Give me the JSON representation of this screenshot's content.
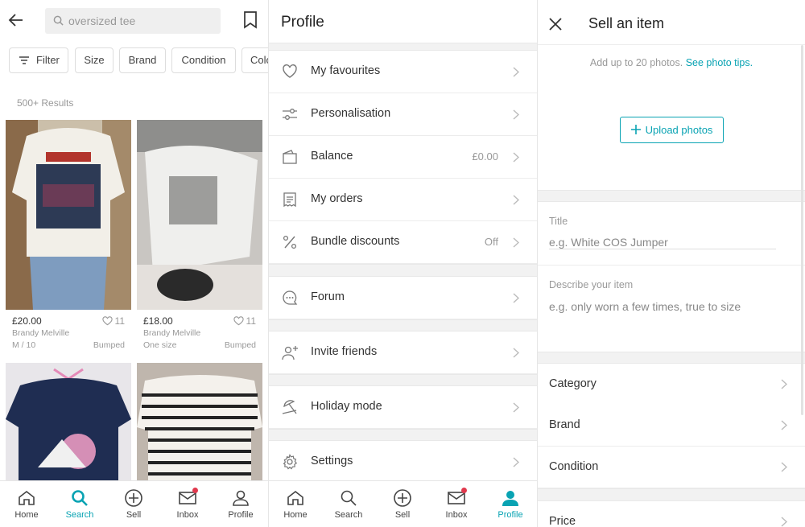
{
  "search_screen": {
    "query": "oversized tee",
    "filters": [
      "Filter",
      "Size",
      "Brand",
      "Condition",
      "Colour"
    ],
    "results_count": "500+ Results",
    "items": [
      {
        "price": "£20.00",
        "likes": "11",
        "brand": "Brandy Melville",
        "size": "M / 10",
        "status": "Bumped"
      },
      {
        "price": "£18.00",
        "likes": "11",
        "brand": "Brandy Melville",
        "size": "One size",
        "status": "Bumped"
      },
      {
        "price": "",
        "likes": "",
        "brand": "",
        "size": "",
        "status": ""
      },
      {
        "price": "",
        "likes": "",
        "brand": "",
        "size": "",
        "status": ""
      }
    ],
    "nav": [
      {
        "label": "Home",
        "icon": "home-icon",
        "active": false
      },
      {
        "label": "Search",
        "icon": "search-icon",
        "active": true
      },
      {
        "label": "Sell",
        "icon": "plus-circle-icon",
        "active": false
      },
      {
        "label": "Inbox",
        "icon": "inbox-icon",
        "active": false,
        "badge": true
      },
      {
        "label": "Profile",
        "icon": "person-icon",
        "active": false
      }
    ]
  },
  "profile_screen": {
    "title": "Profile",
    "menu": [
      {
        "label": "My favourites",
        "value": "",
        "icon": "heart-icon"
      },
      {
        "label": "Personalisation",
        "value": "",
        "icon": "sliders-icon"
      },
      {
        "label": "Balance",
        "value": "£0.00",
        "icon": "wallet-icon"
      },
      {
        "label": "My orders",
        "value": "",
        "icon": "receipt-icon"
      },
      {
        "label": "Bundle discounts",
        "value": "Off",
        "icon": "percent-icon"
      },
      {
        "label": "Forum",
        "value": "",
        "icon": "chat-bubble-icon"
      },
      {
        "label": "Invite friends",
        "value": "",
        "icon": "add-person-icon"
      },
      {
        "label": "Holiday mode",
        "value": "",
        "icon": "beach-umbrella-icon"
      },
      {
        "label": "Settings",
        "value": "",
        "icon": "gear-icon"
      }
    ],
    "nav": [
      {
        "label": "Home",
        "icon": "home-icon",
        "active": false
      },
      {
        "label": "Search",
        "icon": "search-icon",
        "active": false
      },
      {
        "label": "Sell",
        "icon": "plus-circle-icon",
        "active": false
      },
      {
        "label": "Inbox",
        "icon": "inbox-icon",
        "active": false,
        "badge": true
      },
      {
        "label": "Profile",
        "icon": "person-icon",
        "active": true
      }
    ]
  },
  "sell_screen": {
    "title": "Sell an item",
    "photo_hint": "Add up to 20 photos.",
    "photo_tips_link": "See photo tips.",
    "upload_label": "Upload photos",
    "title_label": "Title",
    "title_placeholder": "e.g. White COS Jumper",
    "describe_label": "Describe your item",
    "describe_placeholder": "e.g. only worn a few times, true to size",
    "fields": [
      "Category",
      "Brand",
      "Condition",
      "Price"
    ]
  },
  "colors": {
    "accent": "#09a3b3",
    "badge": "#e0394d",
    "muted_text": "#999999",
    "section_gap": "#f2f2f2"
  }
}
